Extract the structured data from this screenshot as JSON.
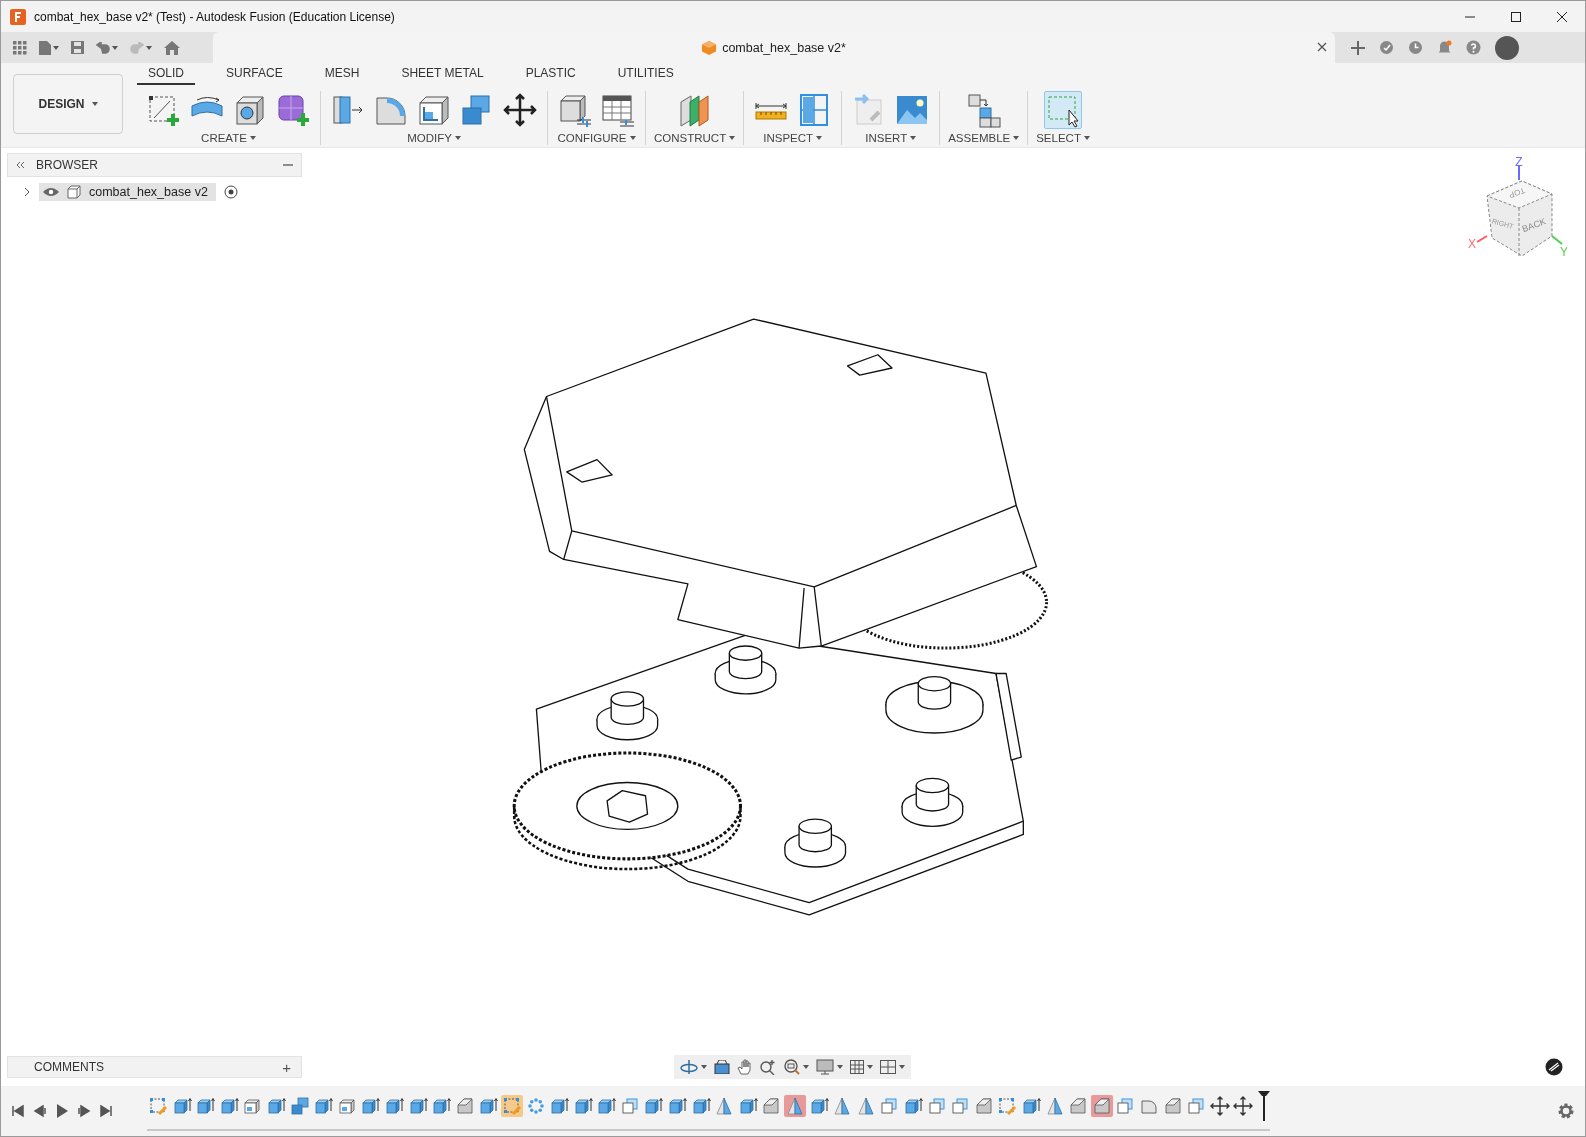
{
  "window": {
    "title": "combat_hex_base v2* (Test) - Autodesk Fusion (Education License)"
  },
  "document_tab": {
    "title": "combat_hex_base v2*"
  },
  "workspace": {
    "label": "DESIGN"
  },
  "ribbon_tabs": [
    {
      "label": "SOLID",
      "selected": true
    },
    {
      "label": "SURFACE",
      "selected": false
    },
    {
      "label": "MESH",
      "selected": false
    },
    {
      "label": "SHEET METAL",
      "selected": false
    },
    {
      "label": "PLASTIC",
      "selected": false
    },
    {
      "label": "UTILITIES",
      "selected": false
    }
  ],
  "tool_groups": [
    {
      "label": "CREATE",
      "tools": [
        {
          "kind": "sketch",
          "active": false
        },
        {
          "kind": "revolve",
          "active": false
        },
        {
          "kind": "hole",
          "active": false
        },
        {
          "kind": "form",
          "active": false
        }
      ]
    },
    {
      "label": "MODIFY",
      "tools": [
        {
          "kind": "presspull",
          "active": false
        },
        {
          "kind": "fillet",
          "active": false
        },
        {
          "kind": "shell",
          "active": false
        },
        {
          "kind": "combine",
          "active": false
        },
        {
          "kind": "move",
          "active": false
        }
      ]
    },
    {
      "label": "CONFIGURE",
      "tools": [
        {
          "kind": "parameters",
          "active": false
        },
        {
          "kind": "table",
          "active": false
        }
      ]
    },
    {
      "label": "CONSTRUCT",
      "tools": [
        {
          "kind": "plane",
          "active": false
        }
      ]
    },
    {
      "label": "INSPECT",
      "tools": [
        {
          "kind": "measure",
          "active": false
        },
        {
          "kind": "section",
          "active": false
        }
      ]
    },
    {
      "label": "INSERT",
      "tools": [
        {
          "kind": "link",
          "active": false
        },
        {
          "kind": "image",
          "active": false
        }
      ]
    },
    {
      "label": "ASSEMBLE",
      "tools": [
        {
          "kind": "joint",
          "active": false
        }
      ]
    },
    {
      "label": "SELECT",
      "tools": [
        {
          "kind": "select",
          "active": true
        }
      ]
    }
  ],
  "browser": {
    "title": "BROWSER",
    "items": [
      {
        "label": "combat_hex_base v2",
        "expanded": false,
        "selected": true
      }
    ]
  },
  "viewcube": {
    "faces": [
      "TOP",
      "RIGHT",
      "BACK"
    ],
    "axes": [
      "X",
      "Y",
      "Z"
    ]
  },
  "comments": {
    "title": "COMMENTS",
    "add": "+"
  },
  "timeline": {
    "features": [
      {
        "kind": "sketch",
        "selected": false,
        "error": false
      },
      {
        "kind": "extrude",
        "selected": false,
        "error": false
      },
      {
        "kind": "extrude",
        "selected": false,
        "error": false
      },
      {
        "kind": "extrude",
        "selected": false,
        "error": false
      },
      {
        "kind": "shell",
        "selected": false,
        "error": false
      },
      {
        "kind": "extrude",
        "selected": false,
        "error": false
      },
      {
        "kind": "combine",
        "selected": false,
        "error": false
      },
      {
        "kind": "extrude",
        "selected": false,
        "error": false
      },
      {
        "kind": "shell",
        "selected": false,
        "error": false
      },
      {
        "kind": "extrude",
        "selected": false,
        "error": false
      },
      {
        "kind": "extrude",
        "selected": false,
        "error": false
      },
      {
        "kind": "extrude",
        "selected": false,
        "error": false
      },
      {
        "kind": "extrude",
        "selected": false,
        "error": false
      },
      {
        "kind": "chamfer",
        "selected": false,
        "error": false
      },
      {
        "kind": "extrude",
        "selected": false,
        "error": false
      },
      {
        "kind": "sketch",
        "selected": true,
        "error": false
      },
      {
        "kind": "pattern",
        "selected": false,
        "error": false
      },
      {
        "kind": "extrude",
        "selected": false,
        "error": false
      },
      {
        "kind": "extrude",
        "selected": false,
        "error": false
      },
      {
        "kind": "extrude",
        "selected": false,
        "error": false
      },
      {
        "kind": "body",
        "selected": false,
        "error": false
      },
      {
        "kind": "extrude",
        "selected": false,
        "error": false
      },
      {
        "kind": "extrude",
        "selected": false,
        "error": false
      },
      {
        "kind": "extrude",
        "selected": false,
        "error": false
      },
      {
        "kind": "plane",
        "selected": false,
        "error": false
      },
      {
        "kind": "extrude",
        "selected": false,
        "error": false
      },
      {
        "kind": "chamfer",
        "selected": false,
        "error": false
      },
      {
        "kind": "plane",
        "selected": false,
        "error": true
      },
      {
        "kind": "extrude",
        "selected": false,
        "error": false
      },
      {
        "kind": "plane",
        "selected": false,
        "error": false
      },
      {
        "kind": "plane",
        "selected": false,
        "error": false
      },
      {
        "kind": "body",
        "selected": false,
        "error": false
      },
      {
        "kind": "extrude",
        "selected": false,
        "error": false
      },
      {
        "kind": "body",
        "selected": false,
        "error": false
      },
      {
        "kind": "body",
        "selected": false,
        "error": false
      },
      {
        "kind": "chamfer",
        "selected": false,
        "error": false
      },
      {
        "kind": "sketch",
        "selected": false,
        "error": false
      },
      {
        "kind": "extrude",
        "selected": false,
        "error": false
      },
      {
        "kind": "plane",
        "selected": false,
        "error": false
      },
      {
        "kind": "chamfer",
        "selected": false,
        "error": false
      },
      {
        "kind": "chamfer",
        "selected": false,
        "error": true
      },
      {
        "kind": "body",
        "selected": false,
        "error": false
      },
      {
        "kind": "fillet",
        "selected": false,
        "error": false
      },
      {
        "kind": "chamfer",
        "selected": false,
        "error": false
      },
      {
        "kind": "body",
        "selected": false,
        "error": false
      },
      {
        "kind": "move",
        "selected": false,
        "error": false
      },
      {
        "kind": "move",
        "selected": false,
        "error": false
      }
    ]
  }
}
